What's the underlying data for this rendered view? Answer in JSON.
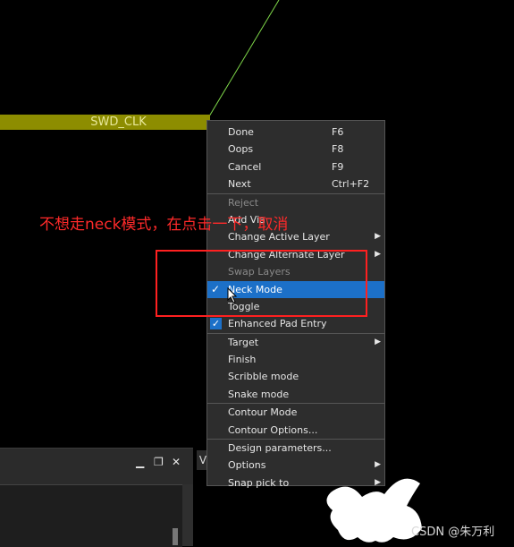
{
  "canvas": {
    "net_label": "SWD_CLK",
    "trace_color": "#8d8d00",
    "ratsnest_color": "#7fd84a"
  },
  "annotation": {
    "text": "不想走neck模式，在点击一下，取消",
    "color": "#ff2a2a"
  },
  "context_menu": {
    "items": [
      {
        "label": "Done",
        "shortcut": "F6"
      },
      {
        "label": "Oops",
        "shortcut": "F8"
      },
      {
        "label": "Cancel",
        "shortcut": "F9"
      },
      {
        "label": "Next",
        "shortcut": "Ctrl+F2"
      },
      {
        "label": "Reject",
        "disabled": true
      },
      {
        "label": "Add Via",
        "submenu": false
      },
      {
        "label": "Change Active Layer",
        "submenu": true
      },
      {
        "label": "Change Alternate Layer",
        "submenu": true
      },
      {
        "label": "Swap Layers",
        "disabled": true
      },
      {
        "label": "Neck Mode",
        "checked": true,
        "selected": true
      },
      {
        "label": "Toggle"
      },
      {
        "label": "Enhanced Pad Entry",
        "checked": true
      },
      {
        "label": "Target",
        "submenu": true
      },
      {
        "label": "Finish"
      },
      {
        "label": "Scribble mode"
      },
      {
        "label": "Snake mode"
      },
      {
        "label": "Contour Mode"
      },
      {
        "label": "Contour Options..."
      },
      {
        "label": "Design parameters..."
      },
      {
        "label": "Options",
        "submenu": true
      },
      {
        "label": "Snap pick to",
        "submenu": true
      }
    ]
  },
  "bottom_panel": {
    "minimize_icon": "minimize-icon",
    "restore_icon": "restore-icon",
    "close_icon": "close-icon",
    "tab_label": "V"
  },
  "watermark": "CSDN @朱万利",
  "accent_color": "#1c70c8"
}
